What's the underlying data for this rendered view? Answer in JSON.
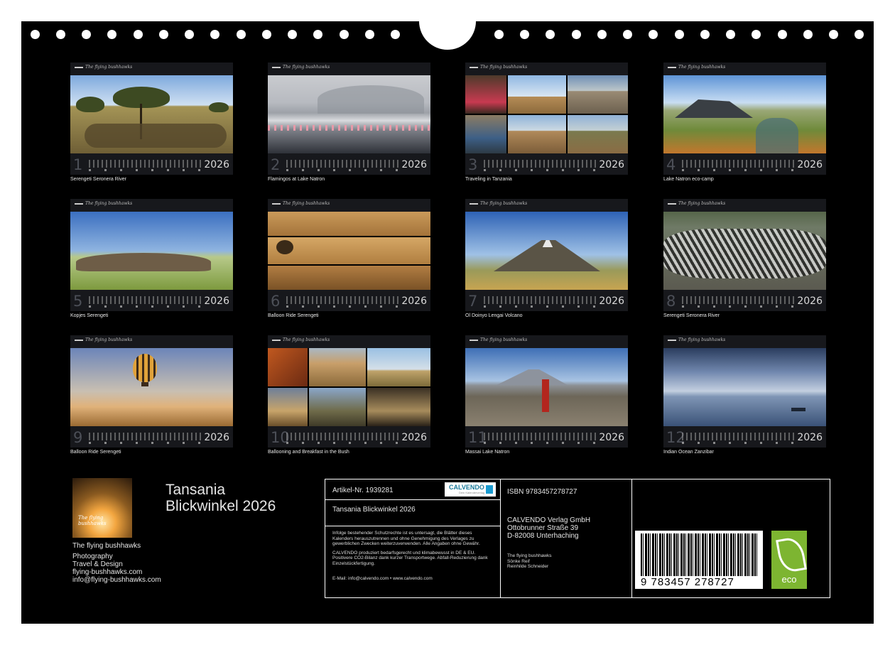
{
  "months": [
    {
      "num": "1",
      "year": "2026",
      "caption": "Serengeti Seronera River"
    },
    {
      "num": "2",
      "year": "2026",
      "caption": "Flamingos at Lake Natron"
    },
    {
      "num": "3",
      "year": "2026",
      "caption": "Traveling in Tanzania"
    },
    {
      "num": "4",
      "year": "2026",
      "caption": "Lake Natron eco-camp"
    },
    {
      "num": "5",
      "year": "2026",
      "caption": "Kopjes Serengeti"
    },
    {
      "num": "6",
      "year": "2026",
      "caption": "Balloon Ride Serengeti"
    },
    {
      "num": "7",
      "year": "2026",
      "caption": "Ol Doinyo Lengai Volcano"
    },
    {
      "num": "8",
      "year": "2026",
      "caption": "Serengeti Seronera River"
    },
    {
      "num": "9",
      "year": "2026",
      "caption": "Balloon Ride Serengeti"
    },
    {
      "num": "10",
      "year": "2026",
      "caption": "Ballooning and Breakfast in the Bush"
    },
    {
      "num": "11",
      "year": "2026",
      "caption": "Massai Lake Natron"
    },
    {
      "num": "12",
      "year": "2026",
      "caption": "Indian Ocean Zanzibar"
    }
  ],
  "brand_logo_text": "The flying bushhawks",
  "author": {
    "name": "The flying bushhawks",
    "line1": "Photography",
    "line2": "Travel & Design",
    "web": "flying-bushhawks.com",
    "email": "info@flying-bushhawks.com"
  },
  "title": {
    "line1": "Tansania",
    "line2": "Blickwinkel 2026"
  },
  "info": {
    "article": "Artikel-Nr. 1939281",
    "calvendo_logo": "CALVENDO",
    "calvendo_sub": "Dein Kalenderverlag",
    "product_title": "Tansania Blickwinkel 2026",
    "legal": "Infolge bestehender Schutzrechte ist es untersagt, die Blätter dieses Kalenders herauszutrennen und ohne Genehmigung des Verlages zu gewerblichen Zwecken weiterzuverwenden. Alle Angaben ohne Gewähr.",
    "eco_text": "CALVENDO produziert bedarfsgerecht und klimabewusst in DE & EU. Positivere CO2-Bilanz dank kurzer Transportwege. Abfall-Reduzierung dank Einzelstückfertigung.",
    "contact": "E-Mail: info@calvendo.com • www.calvendo.com",
    "isbn": "ISBN 9783457278727",
    "publisher1": "CALVENDO Verlag GmbH",
    "publisher2": "Ottobrunner Straße 39",
    "publisher3": "D-82008 Unterhaching",
    "credit1": "The flying bushhawks",
    "credit2": "Sönke Reif",
    "credit3": "Reinhilde Schneider",
    "barcode_number": "9 783457 278727",
    "eco_label": "eco"
  },
  "colors": {
    "background": "#000000",
    "eco_green": "#7db531",
    "calvendo_blue": "#1a9bd0"
  }
}
